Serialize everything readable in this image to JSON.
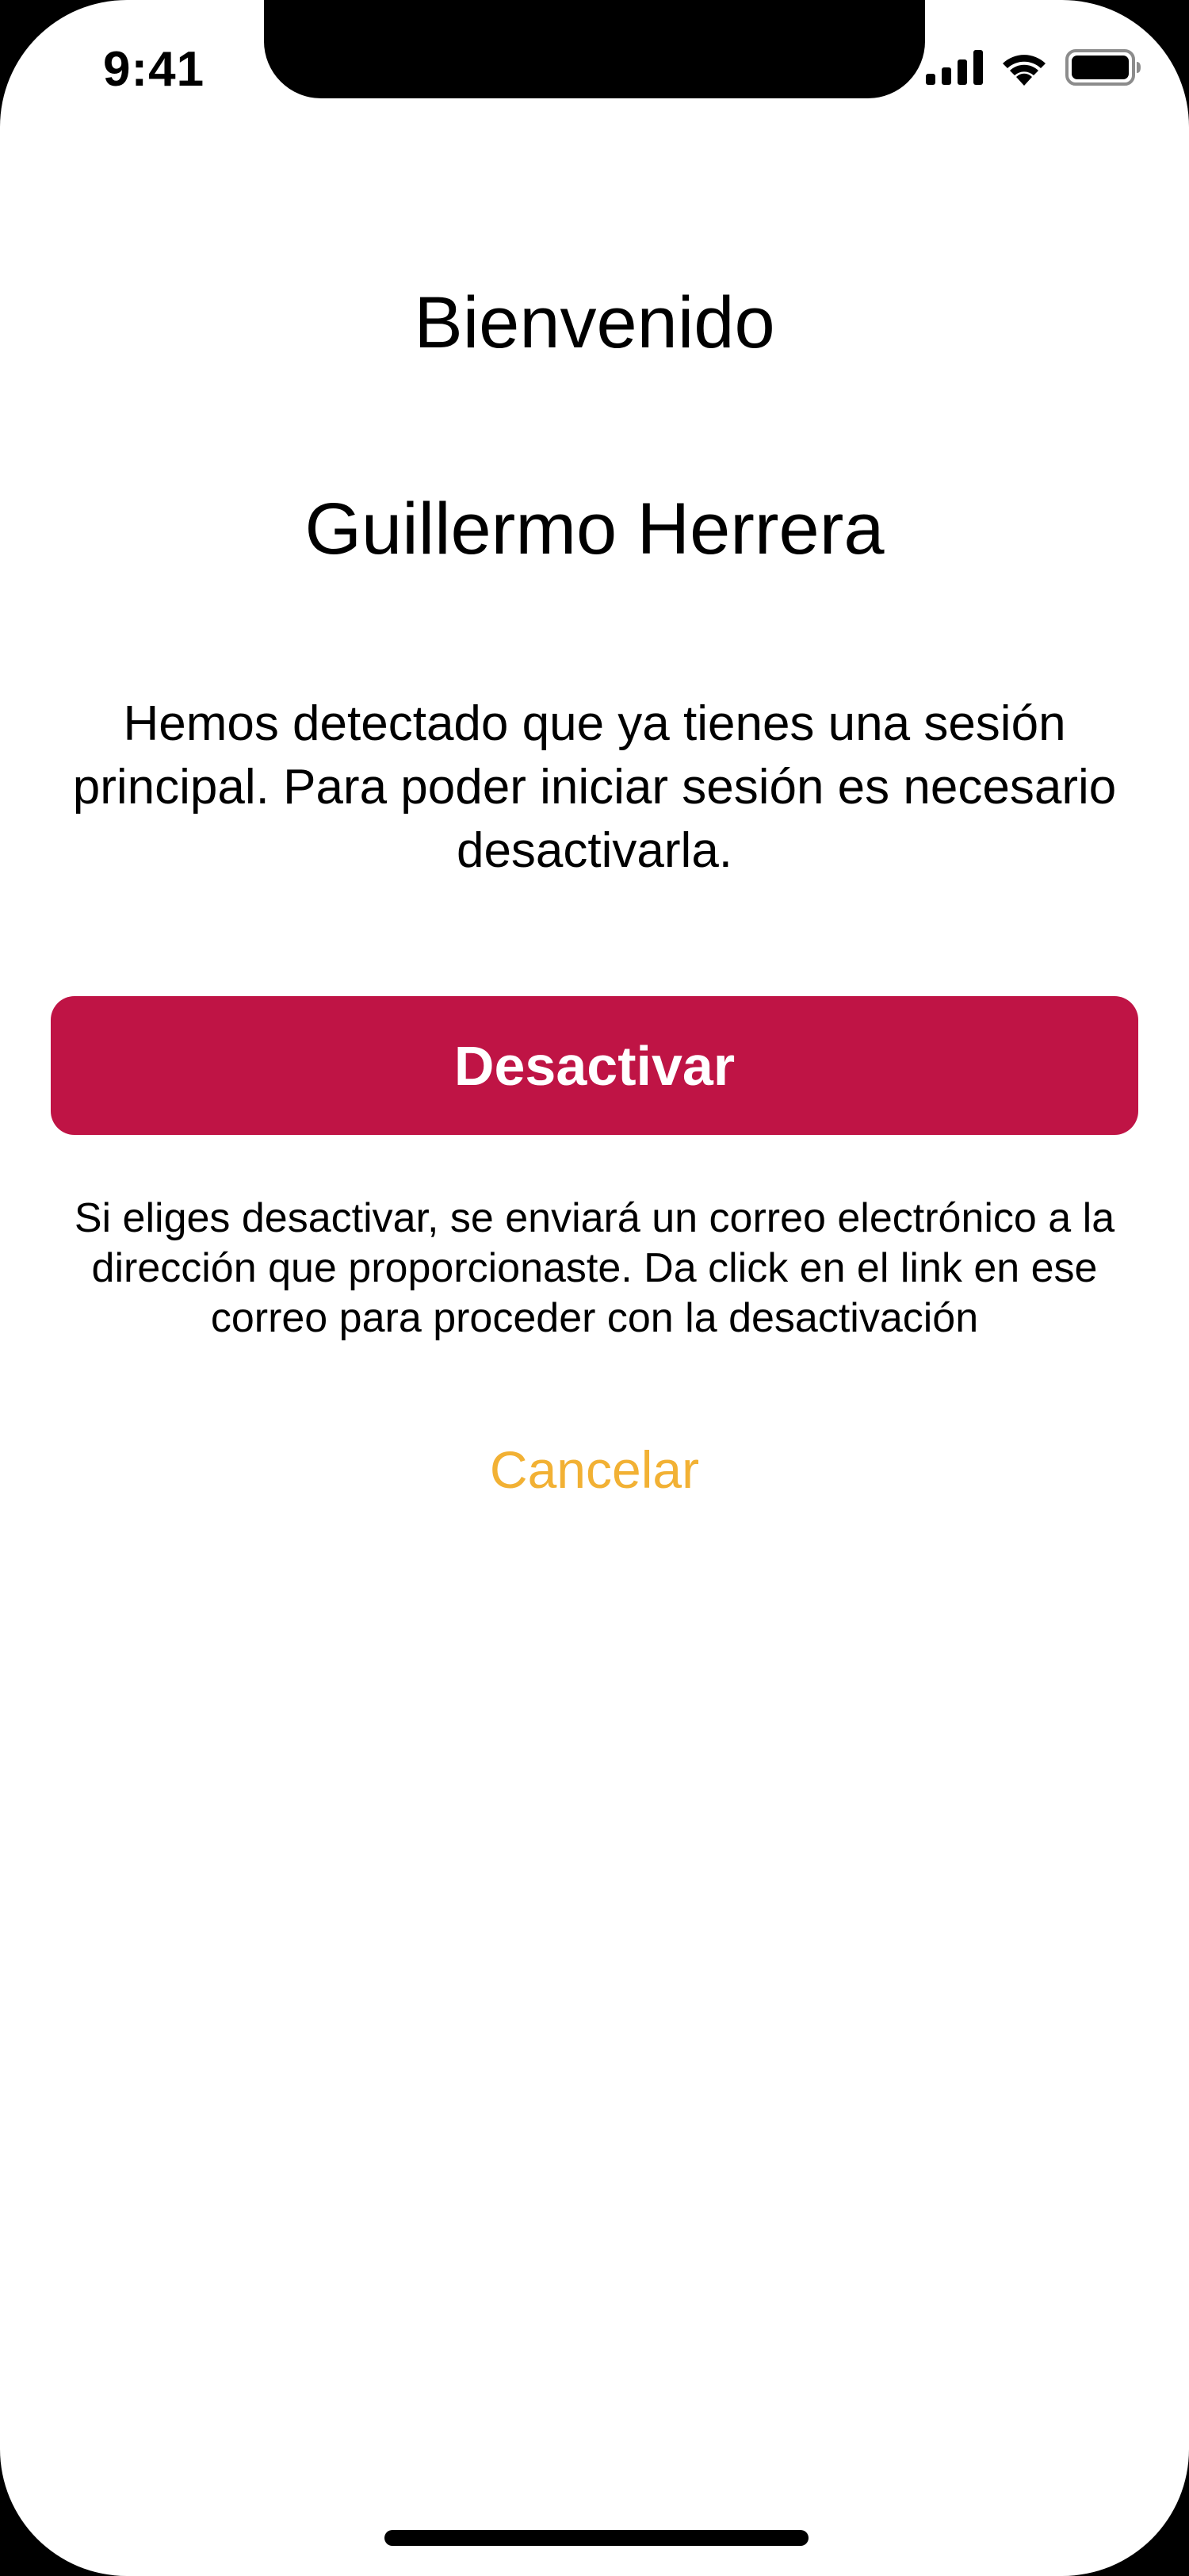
{
  "status_bar": {
    "time": "9:41",
    "icons": [
      "signal-icon",
      "wifi-icon",
      "battery-icon"
    ]
  },
  "screen": {
    "title": "Bienvenido",
    "user_name": "Guillermo Herrera",
    "message": "Hemos detectado que ya tienes una sesión principal. Para poder iniciar sesión es necesario desactivarla.",
    "deactivate_label": "Desactivar",
    "note": "Si eliges desactivar, se enviará un correo electrónico a la dirección que proporcionaste. Da click en el link en ese correo para proceder con la desactivación",
    "cancel_label": "Cancelar"
  },
  "colors": {
    "primary_button": "#bf1445",
    "cancel_link": "#f2b134",
    "background": "#ffffff",
    "text": "#000000"
  }
}
